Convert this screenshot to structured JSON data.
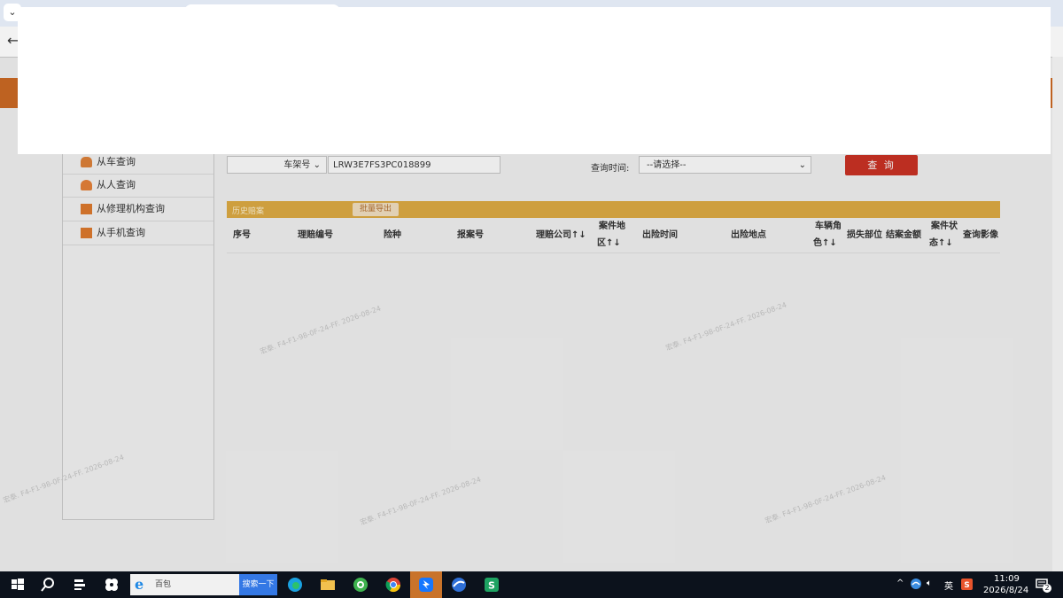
{
  "browser": {
    "tab_chevron": "⌄",
    "back_arrow": "←"
  },
  "sidebar": {
    "items": [
      {
        "label": "从车查询",
        "icon": "car-icon"
      },
      {
        "label": "从人查询",
        "icon": "person-icon"
      },
      {
        "label": "从修理机构查询",
        "icon": "repair-shop-icon"
      },
      {
        "label": "从手机查询",
        "icon": "phone-icon"
      }
    ]
  },
  "search": {
    "field_type": "车架号",
    "field_value": "LRW3E7FS3PC018899",
    "time_label": "查询时间:",
    "time_placeholder": "--请选择--",
    "query_button": "查 询"
  },
  "history": {
    "title": "历史赔案",
    "export_button": "批量导出"
  },
  "table": {
    "headers": [
      {
        "label": "序号"
      },
      {
        "label": "理赔编号"
      },
      {
        "label": "险种"
      },
      {
        "label": "报案号"
      },
      {
        "label": "理赔公司↑↓"
      },
      {
        "label_line1": "案件地",
        "label_line2": "区↑↓"
      },
      {
        "label": "出险时间"
      },
      {
        "label": "出险地点"
      },
      {
        "label_line1": "车辆角",
        "label_line2": "色↑↓"
      },
      {
        "label": "损失部位"
      },
      {
        "label": "结案金额"
      },
      {
        "label_line1": "案件状",
        "label_line2": "态↑↓"
      },
      {
        "label": "查询影像"
      }
    ]
  },
  "watermark": {
    "text": "宏泰. F4-F1-98-0F-24-FF. 2026-08-24"
  },
  "taskbar": {
    "search_text": "百包",
    "search_button": "搜索一下",
    "ime": "英",
    "time": "11:09",
    "date": "2026/8/24",
    "notification_count": "2"
  }
}
